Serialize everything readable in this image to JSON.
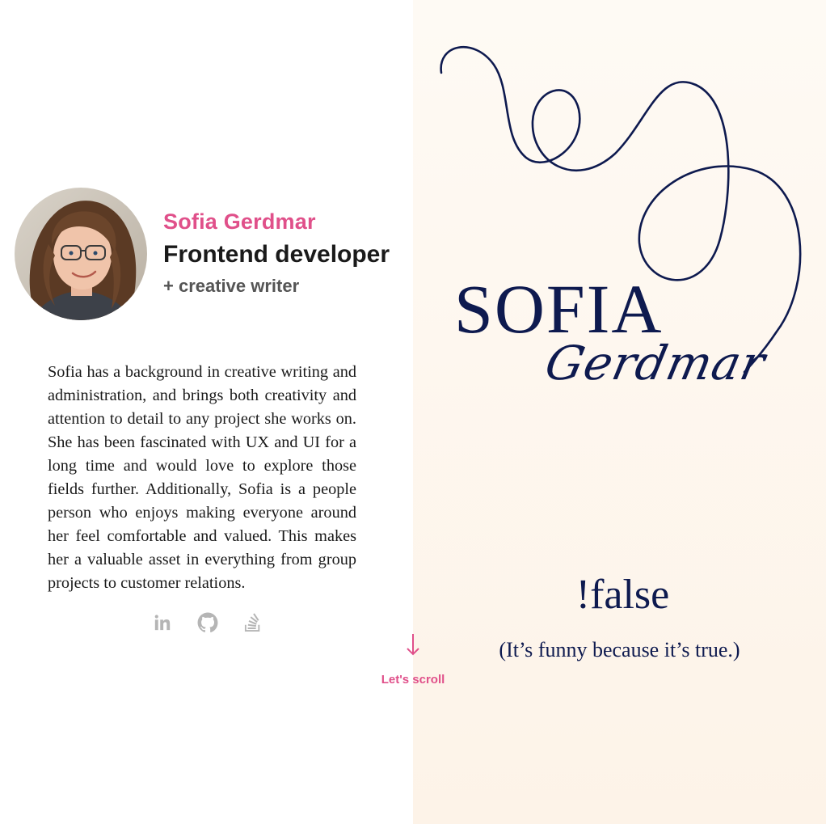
{
  "profile": {
    "name": "Sofia Gerdmar",
    "role": "Frontend developer",
    "subrole": "+ creative writer",
    "bio": "Sofia has a background in creative writing and administration, and brings both creativity and attention to detail to any project she works on. She has been fascinated with UX and UI for a long time and would love to explore those fields further. Additionally, Sofia is a people person who enjoys making everyone around her feel comfortable and valued. This makes her a valuable asset in everything from group projects to customer relations."
  },
  "socials": [
    {
      "icon": "linkedin-icon"
    },
    {
      "icon": "github-icon"
    },
    {
      "icon": "stackoverflow-icon"
    }
  ],
  "scroll": {
    "label": "Let's scroll"
  },
  "logo": {
    "first": "SOFIA",
    "last": "Gerdmar"
  },
  "tagline": {
    "main": "!false",
    "sub": "(It’s funny because it’s true.)"
  },
  "colors": {
    "accent": "#e0508a",
    "navy": "#0e1a4f",
    "right_bg": "#fdf6ee",
    "icon_gray": "#b5b5b5"
  }
}
